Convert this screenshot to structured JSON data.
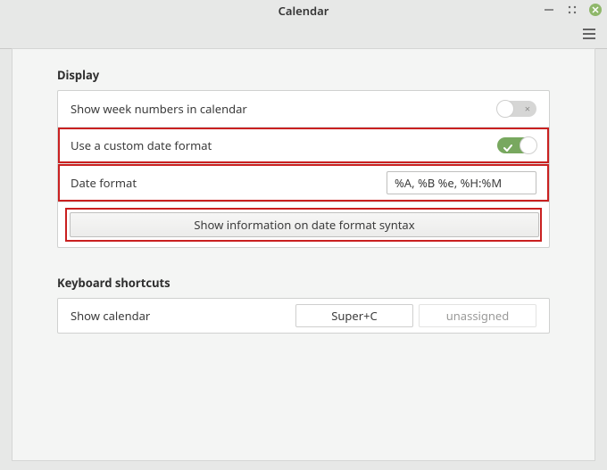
{
  "window": {
    "title": "Calendar"
  },
  "display": {
    "section_title": "Display",
    "show_week_numbers": {
      "label": "Show week numbers in calendar",
      "on": false
    },
    "use_custom_format": {
      "label": "Use a custom date format",
      "on": true
    },
    "date_format": {
      "label": "Date format",
      "value": "%A, %B %e, %H:%M"
    },
    "syntax_button": "Show information on date format syntax"
  },
  "shortcuts": {
    "section_title": "Keyboard shortcuts",
    "rows": [
      {
        "label": "Show calendar",
        "primary": "Super+C",
        "secondary": "unassigned"
      }
    ]
  }
}
